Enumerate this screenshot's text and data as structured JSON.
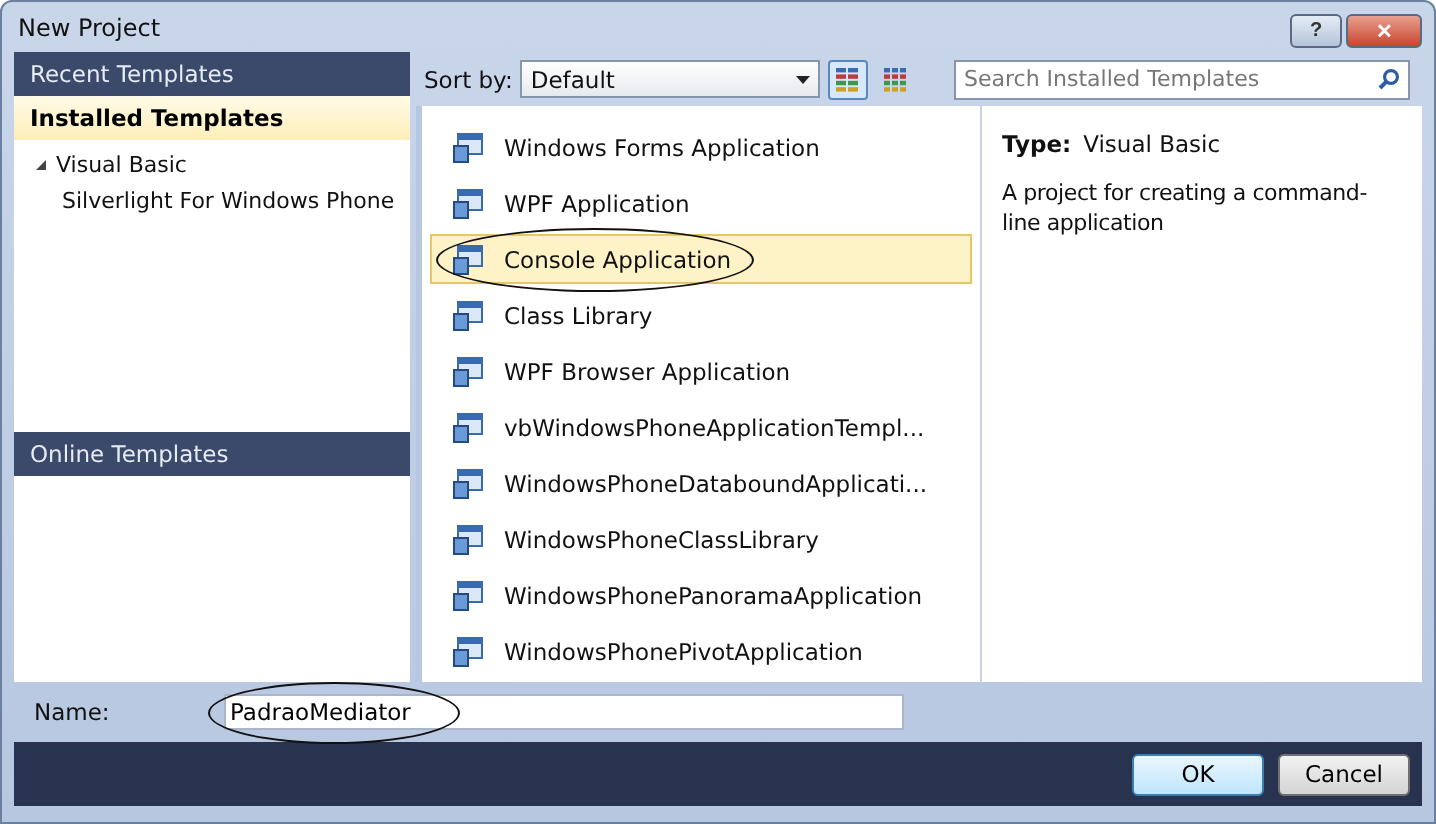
{
  "window": {
    "title": "New Project",
    "buttons": [
      {
        "kind": "help",
        "label": "?"
      },
      {
        "kind": "close",
        "label": "✕"
      }
    ]
  },
  "sidebar": {
    "sections": [
      {
        "label": "Recent Templates",
        "selected": false
      },
      {
        "label": "Installed Templates",
        "selected": true,
        "children": [
          {
            "label": "Visual Basic",
            "expanded": true,
            "children": [
              {
                "label": "Silverlight For Windows Phone"
              }
            ]
          }
        ]
      },
      {
        "label": "Online Templates",
        "selected": false
      }
    ]
  },
  "toolbar": {
    "sort_label": "Sort by:",
    "sort_value": "Default",
    "views": [
      {
        "kind": "medium",
        "selected": true
      },
      {
        "kind": "small",
        "selected": false
      }
    ],
    "search": {
      "placeholder": "Search Installed Templates"
    }
  },
  "templates": [
    {
      "label": "Windows Forms Application",
      "selected": false,
      "annotated": false
    },
    {
      "label": "WPF Application",
      "selected": false,
      "annotated": false
    },
    {
      "label": "Console Application",
      "selected": true,
      "annotated": true
    },
    {
      "label": "Class Library",
      "selected": false,
      "annotated": false
    },
    {
      "label": "WPF Browser Application",
      "selected": false,
      "annotated": false
    },
    {
      "label": "vbWindowsPhoneApplicationTempl...",
      "selected": false,
      "annotated": false
    },
    {
      "label": "WindowsPhoneDataboundApplicati...",
      "selected": false,
      "annotated": false
    },
    {
      "label": "WindowsPhoneClassLibrary",
      "selected": false,
      "annotated": false
    },
    {
      "label": "WindowsPhonePanoramaApplication",
      "selected": false,
      "annotated": false
    },
    {
      "label": "WindowsPhonePivotApplication",
      "selected": false,
      "annotated": false
    }
  ],
  "details": {
    "type_label": "Type:",
    "type_value": "Visual Basic",
    "description": "A project for creating a command-line application"
  },
  "name_field": {
    "label": "Name:",
    "value": "PadraoMediator",
    "annotated": true
  },
  "buttons": [
    {
      "label": "OK",
      "default": true
    },
    {
      "label": "Cancel",
      "default": false
    }
  ]
}
